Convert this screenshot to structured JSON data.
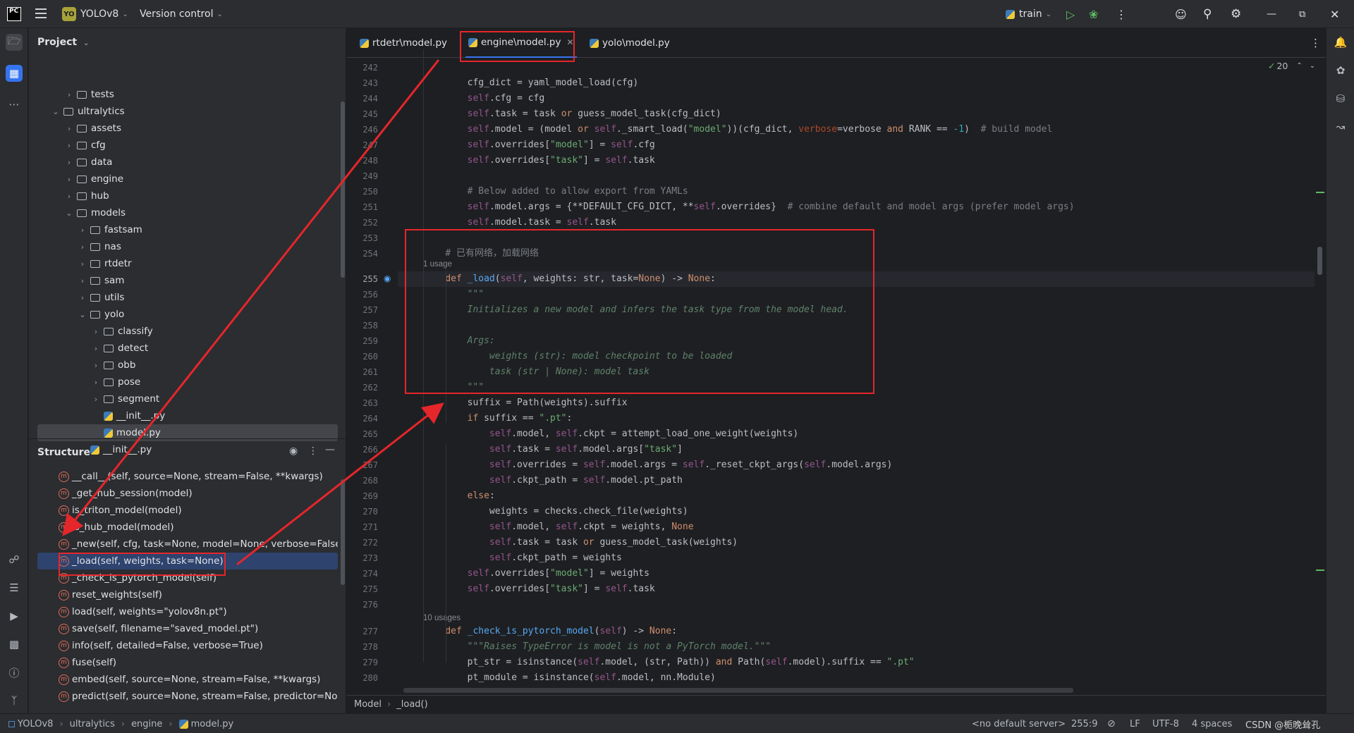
{
  "topbar": {
    "logo": "PC",
    "project_badge": "YO",
    "project_name": "YOLOv8",
    "version_control": "Version control",
    "run_config": "train"
  },
  "project_panel": {
    "title": "Project",
    "tree": [
      {
        "label": "tests",
        "type": "folder",
        "level": 2,
        "expanded": false
      },
      {
        "label": "ultralytics",
        "type": "folder",
        "level": 1,
        "expanded": true
      },
      {
        "label": "assets",
        "type": "folder",
        "level": 2,
        "expanded": false
      },
      {
        "label": "cfg",
        "type": "folder",
        "level": 2,
        "expanded": false
      },
      {
        "label": "data",
        "type": "folder",
        "level": 2,
        "expanded": false
      },
      {
        "label": "engine",
        "type": "folder",
        "level": 2,
        "expanded": false
      },
      {
        "label": "hub",
        "type": "folder",
        "level": 2,
        "expanded": false
      },
      {
        "label": "models",
        "type": "folder",
        "level": 2,
        "expanded": true
      },
      {
        "label": "fastsam",
        "type": "folder",
        "level": 3,
        "expanded": false
      },
      {
        "label": "nas",
        "type": "folder",
        "level": 3,
        "expanded": false
      },
      {
        "label": "rtdetr",
        "type": "folder",
        "level": 3,
        "expanded": false
      },
      {
        "label": "sam",
        "type": "folder",
        "level": 3,
        "expanded": false
      },
      {
        "label": "utils",
        "type": "folder",
        "level": 3,
        "expanded": false
      },
      {
        "label": "yolo",
        "type": "folder",
        "level": 3,
        "expanded": true
      },
      {
        "label": "classify",
        "type": "folder",
        "level": 4,
        "expanded": false
      },
      {
        "label": "detect",
        "type": "folder",
        "level": 4,
        "expanded": false
      },
      {
        "label": "obb",
        "type": "folder",
        "level": 4,
        "expanded": false
      },
      {
        "label": "pose",
        "type": "folder",
        "level": 4,
        "expanded": false
      },
      {
        "label": "segment",
        "type": "folder",
        "level": 4,
        "expanded": false
      },
      {
        "label": "__init__.py",
        "type": "py",
        "level": 4
      },
      {
        "label": "model.py",
        "type": "py",
        "level": 4,
        "selected": true
      },
      {
        "label": "__init__.py",
        "type": "py",
        "level": 3
      }
    ]
  },
  "structure_panel": {
    "title": "Structure",
    "items": [
      "__call__(self, source=None, stream=False, **kwargs)",
      "_get_hub_session(model)",
      "is_triton_model(model)",
      "is_hub_model(model)",
      "_new(self, cfg, task=None, model=None, verbose=False)",
      "_load(self, weights, task=None)",
      "_check_is_pytorch_model(self)",
      "reset_weights(self)",
      "load(self, weights=\"yolov8n.pt\")",
      "save(self, filename=\"saved_model.pt\")",
      "info(self, detailed=False, verbose=True)",
      "fuse(self)",
      "embed(self, source=None, stream=False, **kwargs)",
      "predict(self, source=None, stream=False, predictor=None, *"
    ],
    "selected_index": 5
  },
  "editor": {
    "tabs": [
      {
        "label": "rtdetr\\model.py",
        "active": false
      },
      {
        "label": "engine\\model.py",
        "active": true
      },
      {
        "label": "yolo\\model.py",
        "active": false
      }
    ],
    "inspection_count": "20",
    "hint_1_usage": "1 usage",
    "hint_10_usages": "10 usages",
    "current_line": "255",
    "breadcrumb": [
      "Model",
      "_load()"
    ]
  },
  "code_lines": [
    {
      "n": "242",
      "html": ""
    },
    {
      "n": "243",
      "html": "        cfg_dict = yaml_model_load(cfg)"
    },
    {
      "n": "244",
      "html": "        <span class='sf'>self</span>.cfg = cfg"
    },
    {
      "n": "245",
      "html": "        <span class='sf'>self</span>.task = task <span class='kw'>or</span> guess_model_task(cfg_dict)"
    },
    {
      "n": "246",
      "html": "        <span class='sf'>self</span>.model = (model <span class='kw'>or</span> <span class='sf'>self</span>._smart_load(<span class='st'>\"model\"</span>))(cfg_dict, <span class='par'>verbose</span>=verbose <span class='kw'>and</span> RANK == <span class='num'>-1</span>)  <span class='cm'># build model</span>"
    },
    {
      "n": "247",
      "html": "        <span class='sf'>self</span>.overrides[<span class='st'>\"model\"</span>] = <span class='sf'>self</span>.cfg"
    },
    {
      "n": "248",
      "html": "        <span class='sf'>self</span>.overrides[<span class='st'>\"task\"</span>] = <span class='sf'>self</span>.task"
    },
    {
      "n": "249",
      "html": ""
    },
    {
      "n": "250",
      "html": "        <span class='cm'># Below added to allow export from YAMLs</span>"
    },
    {
      "n": "251",
      "html": "        <span class='sf'>self</span>.model.args = {**DEFAULT_CFG_DICT, **<span class='sf'>self</span>.overrides}  <span class='cm'># combine default and model args (prefer model args)</span>"
    },
    {
      "n": "252",
      "html": "        <span class='sf'>self</span>.model.task = <span class='sf'>self</span>.task"
    },
    {
      "n": "253",
      "html": ""
    },
    {
      "n": "254",
      "html": "    <span class='cm'># 已有网络，加载网络</span>"
    },
    {
      "n": "255",
      "html": "    <span class='kw'>def</span> <span class='fn'>_load</span>(<span class='sf'>self</span>, weights: str, task=<span class='kw'>None</span>) -&gt; <span class='kw'>None</span>:"
    },
    {
      "n": "256",
      "html": "        <span class='doc'>\"\"\"</span>"
    },
    {
      "n": "257",
      "html": "        <span class='doc'>Initializes a new model and infers the task type from the model head.</span>"
    },
    {
      "n": "258",
      "html": ""
    },
    {
      "n": "259",
      "html": "        <span class='doc'>Args:</span>"
    },
    {
      "n": "260",
      "html": "            <span class='doc'>weights (str): model checkpoint to be loaded</span>"
    },
    {
      "n": "261",
      "html": "            <span class='doc'>task (str | None): model task</span>"
    },
    {
      "n": "262",
      "html": "        <span class='doc'>\"\"\"</span>"
    },
    {
      "n": "263",
      "html": "        suffix = Path(weights).suffix"
    },
    {
      "n": "264",
      "html": "        <span class='kw'>if</span> suffix == <span class='st'>\".pt\"</span>:"
    },
    {
      "n": "265",
      "html": "            <span class='sf'>self</span>.model, <span class='sf'>self</span>.ckpt = attempt_load_one_weight(weights)"
    },
    {
      "n": "266",
      "html": "            <span class='sf'>self</span>.task = <span class='sf'>self</span>.model.args[<span class='st'>\"task\"</span>]"
    },
    {
      "n": "267",
      "html": "            <span class='sf'>self</span>.overrides = <span class='sf'>self</span>.model.args = <span class='sf'>self</span>._reset_ckpt_args(<span class='sf'>self</span>.model.args)"
    },
    {
      "n": "268",
      "html": "            <span class='sf'>self</span>.ckpt_path = <span class='sf'>self</span>.model.pt_path"
    },
    {
      "n": "269",
      "html": "        <span class='kw'>else</span>:"
    },
    {
      "n": "270",
      "html": "            weights = checks.check_file(weights)"
    },
    {
      "n": "271",
      "html": "            <span class='sf'>self</span>.model, <span class='sf'>self</span>.ckpt = weights, <span class='kw'>None</span>"
    },
    {
      "n": "272",
      "html": "            <span class='sf'>self</span>.task = task <span class='kw'>or</span> guess_model_task(weights)"
    },
    {
      "n": "273",
      "html": "            <span class='sf'>self</span>.ckpt_path = weights"
    },
    {
      "n": "274",
      "html": "        <span class='sf'>self</span>.overrides[<span class='st'>\"model\"</span>] = weights"
    },
    {
      "n": "275",
      "html": "        <span class='sf'>self</span>.overrides[<span class='st'>\"task\"</span>] = <span class='sf'>self</span>.task"
    },
    {
      "n": "276",
      "html": ""
    },
    {
      "n": "277",
      "html": "    <span class='kw'>def</span> <span class='fn'>_check_is_pytorch_model</span>(<span class='sf'>self</span>) -&gt; <span class='kw'>None</span>:"
    },
    {
      "n": "278",
      "html": "        <span class='doc'>\"\"\"Raises TypeError is model is not a PyTorch model.\"\"\"</span>"
    },
    {
      "n": "279",
      "html": "        pt_str = isinstance(<span class='sf'>self</span>.model, (str, Path)) <span class='kw'>and</span> Path(<span class='sf'>self</span>.model).suffix == <span class='st'>\".pt\"</span>"
    },
    {
      "n": "280",
      "html": "        pt_module = isinstance(<span class='sf'>self</span>.model, nn.Module)"
    }
  ],
  "statusbar": {
    "path": [
      "YOLOv8",
      "ultralytics",
      "engine",
      "model.py"
    ],
    "server": "<no default server>",
    "position": "255:9",
    "line_sep": "LF",
    "encoding": "UTF-8",
    "indent": "4 spaces",
    "watermark": "CSDN @栀晚耸孔"
  },
  "colors": {
    "annotation_red": "#e5262b",
    "accent": "#3574f0"
  }
}
